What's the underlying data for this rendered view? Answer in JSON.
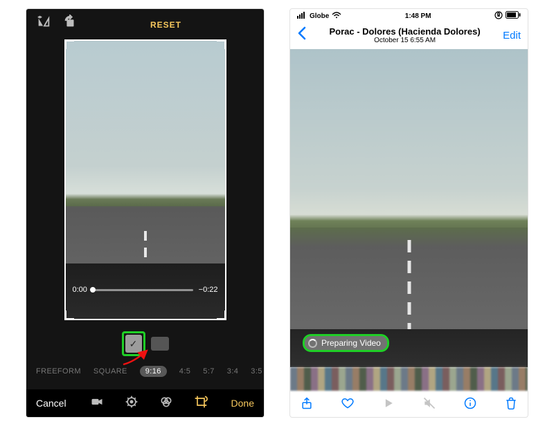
{
  "left": {
    "reset_label": "RESET",
    "orientation": {
      "portrait_checked": true
    },
    "time": {
      "start": "0:00",
      "end": "−0:22"
    },
    "ratios": [
      "FREEFORM",
      "SQUARE",
      "9:16",
      "4:5",
      "5:7",
      "3:4",
      "3:5"
    ],
    "ratio_selected_index": 2,
    "bottom": {
      "cancel": "Cancel",
      "done": "Done"
    }
  },
  "right": {
    "status": {
      "carrier": "Globe",
      "time": "1:48 PM"
    },
    "header": {
      "title": "Porac - Dolores (Hacienda Dolores)",
      "subtitle": "October 15  6:55 AM",
      "edit": "Edit"
    },
    "preparing": "Preparing Video"
  }
}
